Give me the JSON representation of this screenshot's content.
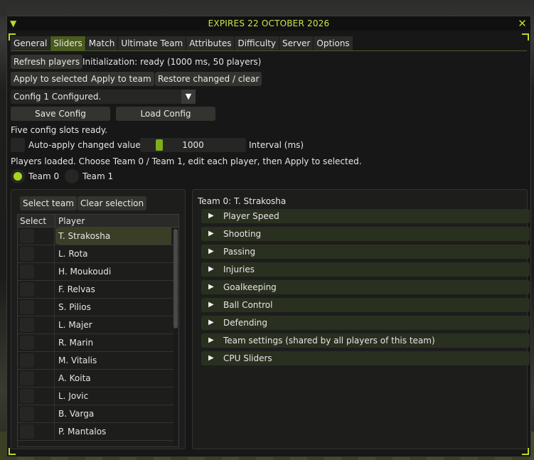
{
  "window": {
    "title": "EXPIRES 22 OCTOBER 2026",
    "accent": "#b8dc22"
  },
  "tabs": [
    {
      "label": "General",
      "active": false
    },
    {
      "label": "Sliders",
      "active": true
    },
    {
      "label": "Match",
      "active": false
    },
    {
      "label": "Ultimate Team",
      "active": false
    },
    {
      "label": "Attributes",
      "active": false
    },
    {
      "label": "Difficulty",
      "active": false
    },
    {
      "label": "Server",
      "active": false
    },
    {
      "label": "Options",
      "active": false
    }
  ],
  "toolbar": {
    "refresh_label": "Refresh players",
    "init_status": "Initialization: ready (1000 ms, 50 players)",
    "apply_selected_label": "Apply to selected",
    "apply_team_label": "Apply to team",
    "restore_label": "Restore changed / clear"
  },
  "config": {
    "selected": "Config 1 Configured.",
    "save_label": "Save Config",
    "load_label": "Load Config",
    "slots_status": "Five config slots ready."
  },
  "auto_apply": {
    "label": "Auto-apply changed values",
    "checked": false,
    "interval_value": "1000",
    "interval_label": "Interval (ms)"
  },
  "players_status": "Players loaded. Choose Team 0 / Team 1, edit each player, then Apply to selected.",
  "team_radio": [
    {
      "label": "Team 0",
      "selected": true
    },
    {
      "label": "Team 1",
      "selected": false
    }
  ],
  "left_panel": {
    "select_team_label": "Select team",
    "clear_selection_label": "Clear selection",
    "columns": [
      "Select",
      "Player"
    ],
    "players": [
      "T. Strakosha",
      "L. Rota",
      "H. Moukoudi",
      "F. Relvas",
      "S. Pilios",
      "L. Majer",
      "R. Marin",
      "M. Vitalis",
      "A. Koita",
      "L. Jovic",
      "B. Varga",
      "P. Mantalos"
    ],
    "selected_player": "T. Strakosha"
  },
  "right_panel": {
    "heading": "Team 0: T. Strakosha",
    "sections": [
      "Player Speed",
      "Shooting",
      "Passing",
      "Injuries",
      "Goalkeeping",
      "Ball Control",
      "Defending",
      "Team settings (shared by all players of this team)",
      "CPU Sliders"
    ]
  }
}
